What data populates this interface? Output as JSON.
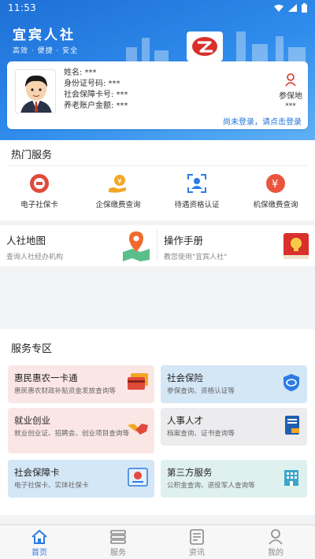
{
  "status_bar": {
    "time": "11:53"
  },
  "brand": {
    "name": "宜宾人社",
    "slogan": "高效 · 便捷 · 安全"
  },
  "user": {
    "name_label": "姓名: ***",
    "id_label": "身份证号码: ***",
    "card_label": "社会保障卡号: ***",
    "pension_label": "养老账户金额: ***",
    "insured_place_label": "参保地",
    "insured_place_value": "***",
    "login_prompt": "尚未登录，请点击登录"
  },
  "hot_services": {
    "title": "热门服务",
    "items": [
      {
        "label": "电子社保卡",
        "icon": "social-card-icon"
      },
      {
        "label": "企保缴费查询",
        "icon": "hand-coin-icon"
      },
      {
        "label": "待遇资格认证",
        "icon": "face-scan-icon"
      },
      {
        "label": "机保缴费查询",
        "icon": "yuan-coin-icon"
      }
    ]
  },
  "tools": [
    {
      "title": "人社地图",
      "subtitle": "查询人社经办机构",
      "icon": "map-pin-icon"
    },
    {
      "title": "操作手册",
      "subtitle": "教您使用\"宜宾人社\"",
      "icon": "manual-book-icon"
    }
  ],
  "service_zone": {
    "title": "服务专区",
    "cards": [
      {
        "title": "惠民惠农一卡通",
        "subtitle": "惠民惠农财政补贴资金发放查询等",
        "icon": "bank-card-icon",
        "bg": "#fbe6e6"
      },
      {
        "title": "社会保险",
        "subtitle": "参保查询、资格认证等",
        "icon": "shield-icon",
        "bg": "#d4e7f7"
      },
      {
        "title": "就业创业",
        "subtitle": "就业创业证、招聘会、创业项目查询等",
        "icon": "handshake-icon",
        "bg": "#fbe6e6"
      },
      {
        "title": "人事人才",
        "subtitle": "档案查询、证书查询等",
        "icon": "certificate-icon",
        "bg": "#ececee"
      },
      {
        "title": "社会保障卡",
        "subtitle": "电子社保卡、实体社保卡",
        "icon": "id-card-icon",
        "bg": "#d4e7f7"
      },
      {
        "title": "第三方服务",
        "subtitle": "公积金查询、退役军人查询等",
        "icon": "building-icon",
        "bg": "#dff1ee"
      }
    ]
  },
  "tabbar": [
    {
      "label": "首页",
      "icon": "home-icon",
      "active": true
    },
    {
      "label": "服务",
      "icon": "service-icon",
      "active": false
    },
    {
      "label": "资讯",
      "icon": "news-icon",
      "active": false
    },
    {
      "label": "我的",
      "icon": "user-icon",
      "active": false
    }
  ],
  "colors": {
    "primary": "#2c7be5",
    "header": "#2f8cec",
    "link": "#1f74d8"
  }
}
